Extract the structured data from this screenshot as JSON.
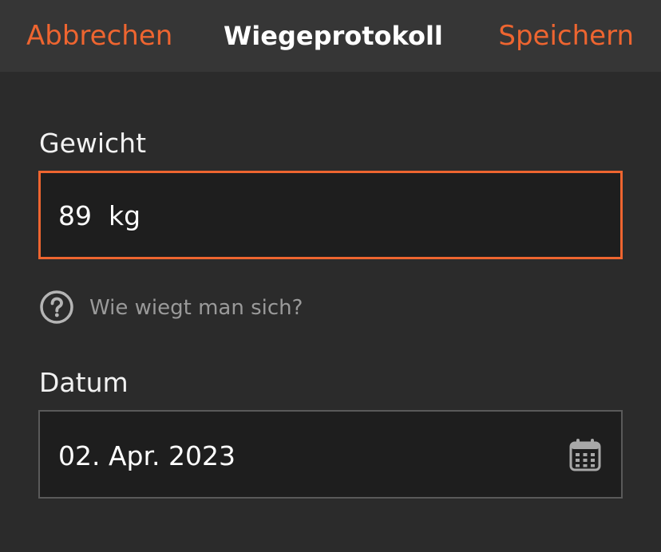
{
  "header": {
    "cancel_label": "Abbrechen",
    "title": "Wiegeprotokoll",
    "save_label": "Speichern"
  },
  "weight": {
    "label": "Gewicht",
    "value": "89",
    "unit": "kg"
  },
  "help": {
    "text": "Wie wiegt man sich?",
    "icon": "question-circle-icon"
  },
  "date": {
    "label": "Datum",
    "value": "02. Apr. 2023",
    "icon": "calendar-icon"
  },
  "colors": {
    "accent": "#ee6530",
    "background": "#2b2b2b",
    "header_background": "#363636",
    "input_background": "#1e1e1e"
  }
}
